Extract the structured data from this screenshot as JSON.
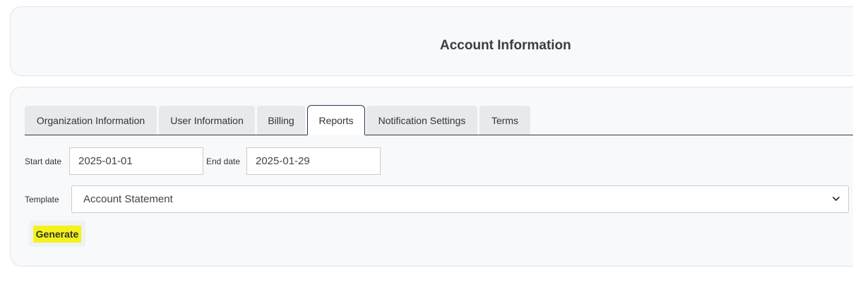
{
  "header": {
    "title": "Account Information"
  },
  "tabs": [
    {
      "label": "Organization Information",
      "active": false
    },
    {
      "label": "User Information",
      "active": false
    },
    {
      "label": "Billing",
      "active": false
    },
    {
      "label": "Reports",
      "active": true
    },
    {
      "label": "Notification Settings",
      "active": false
    },
    {
      "label": "Terms",
      "active": false
    }
  ],
  "form": {
    "start_date_label": "Start date",
    "start_date_value": "2025-01-01",
    "end_date_label": "End date",
    "end_date_value": "2025-01-29",
    "template_label": "Template",
    "template_value": "Account Statement",
    "generate_label": "Generate"
  },
  "colors": {
    "active_tab_border": "#2f3654",
    "highlight": "#f3f31a"
  },
  "icons": {
    "template_dropdown": "chevron-down-icon"
  }
}
